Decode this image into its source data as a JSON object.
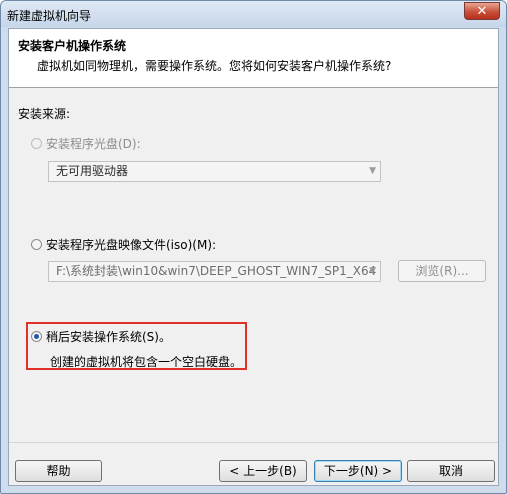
{
  "window": {
    "title": "新建虚拟机向导",
    "close_label": "✕"
  },
  "header": {
    "title": "安装客户机操作系统",
    "subtitle": "虚拟机如同物理机，需要操作系统。您将如何安装客户机操作系统?"
  },
  "source": {
    "label": "安装来源:",
    "disc": {
      "label": "安装程序光盘(D):",
      "selected": false,
      "enabled": false,
      "drive_value": "无可用驱动器"
    },
    "iso": {
      "label": "安装程序光盘映像文件(iso)(M):",
      "selected": false,
      "enabled": true,
      "path_value": "F:\\系统封装\\win10&win7\\DEEP_GHOST_WIN7_SP1_X64",
      "browse_label": "浏览(R)..."
    },
    "later": {
      "label": "稍后安装操作系统(S)。",
      "selected": true,
      "description": "创建的虚拟机将包含一个空白硬盘。"
    }
  },
  "footer": {
    "help_label": "帮助",
    "back_label": "< 上一步(B)",
    "next_label": "下一步(N) >",
    "cancel_label": "取消"
  },
  "colors": {
    "highlight_border": "#e0302a",
    "title_bar": "#cfdcec",
    "close_button": "#c9503a"
  }
}
